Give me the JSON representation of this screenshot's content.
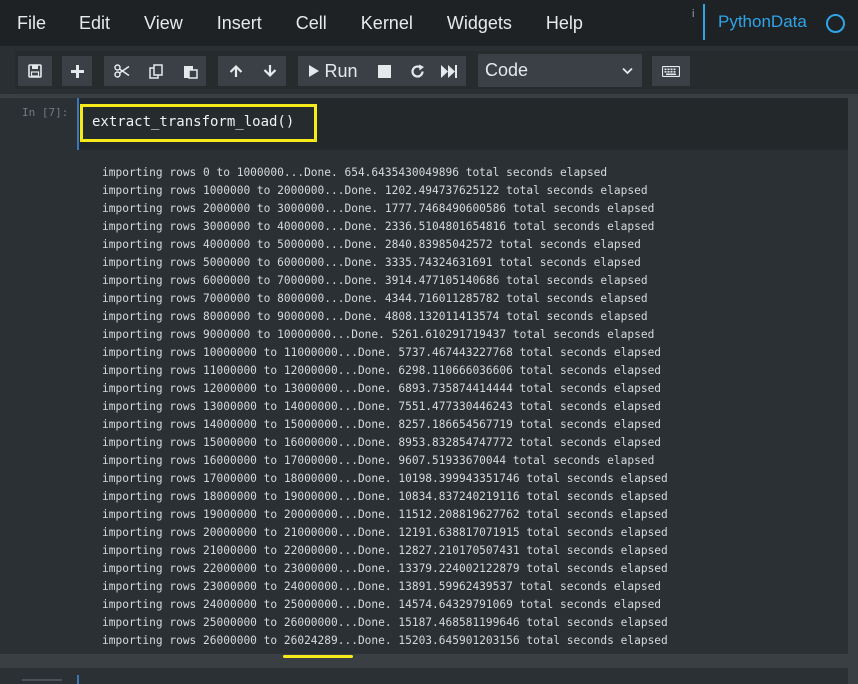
{
  "menubar": {
    "items": [
      "File",
      "Edit",
      "View",
      "Insert",
      "Cell",
      "Kernel",
      "Widgets",
      "Help"
    ],
    "kernel_indicator": "i",
    "kernel_name": "PythonData"
  },
  "toolbar": {
    "run_label": "Run",
    "cell_type": "Code",
    "icons": [
      "save-icon",
      "plus-icon",
      "cut-icon",
      "copy-icon",
      "paste-icon",
      "arrow-up-icon",
      "arrow-down-icon",
      "run-icon",
      "stop-icon",
      "restart-icon",
      "fast-forward-icon",
      "chevron-down-icon",
      "keyboard-icon"
    ]
  },
  "cell": {
    "prompt": "In [7]:",
    "code": "extract_transform_load()",
    "output_lines": [
      "importing rows 0 to 1000000...Done. 654.6435430049896 total seconds elapsed",
      "importing rows 1000000 to 2000000...Done. 1202.494737625122 total seconds elapsed",
      "importing rows 2000000 to 3000000...Done. 1777.7468490600586 total seconds elapsed",
      "importing rows 3000000 to 4000000...Done. 2336.5104801654816 total seconds elapsed",
      "importing rows 4000000 to 5000000...Done. 2840.83985042572 total seconds elapsed",
      "importing rows 5000000 to 6000000...Done. 3335.74324631691 total seconds elapsed",
      "importing rows 6000000 to 7000000...Done. 3914.477105140686 total seconds elapsed",
      "importing rows 7000000 to 8000000...Done. 4344.716011285782 total seconds elapsed",
      "importing rows 8000000 to 9000000...Done. 4808.132011413574 total seconds elapsed",
      "importing rows 9000000 to 10000000...Done. 5261.610291719437 total seconds elapsed",
      "importing rows 10000000 to 11000000...Done. 5737.467443227768 total seconds elapsed",
      "importing rows 11000000 to 12000000...Done. 6298.110666036606 total seconds elapsed",
      "importing rows 12000000 to 13000000...Done. 6893.735874414444 total seconds elapsed",
      "importing rows 13000000 to 14000000...Done. 7551.477330446243 total seconds elapsed",
      "importing rows 14000000 to 15000000...Done. 8257.186654567719 total seconds elapsed",
      "importing rows 15000000 to 16000000...Done. 8953.832854747772 total seconds elapsed",
      "importing rows 16000000 to 17000000...Done. 9607.51933670044 total seconds elapsed",
      "importing rows 17000000 to 18000000...Done. 10198.399943351746 total seconds elapsed",
      "importing rows 18000000 to 19000000...Done. 10834.837240219116 total seconds elapsed",
      "importing rows 19000000 to 20000000...Done. 11512.208819627762 total seconds elapsed",
      "importing rows 20000000 to 21000000...Done. 12191.638817071915 total seconds elapsed",
      "importing rows 21000000 to 22000000...Done. 12827.210170507431 total seconds elapsed",
      "importing rows 22000000 to 23000000...Done. 13379.224002122879 total seconds elapsed",
      "importing rows 23000000 to 24000000...Done. 13891.59962439537 total seconds elapsed",
      "importing rows 24000000 to 25000000...Done. 14574.64329791069 total seconds elapsed",
      "importing rows 25000000 to 26000000...Done. 15187.468581199646 total seconds elapsed",
      "importing rows 26000000 to 26024289...Done. 15203.645901203156 total seconds elapsed"
    ]
  },
  "colors": {
    "accent": "#2fa4e7",
    "highlight": "#f6ea1a",
    "menubar_bg": "#1e2225",
    "cell_bg": "#2b3034"
  }
}
